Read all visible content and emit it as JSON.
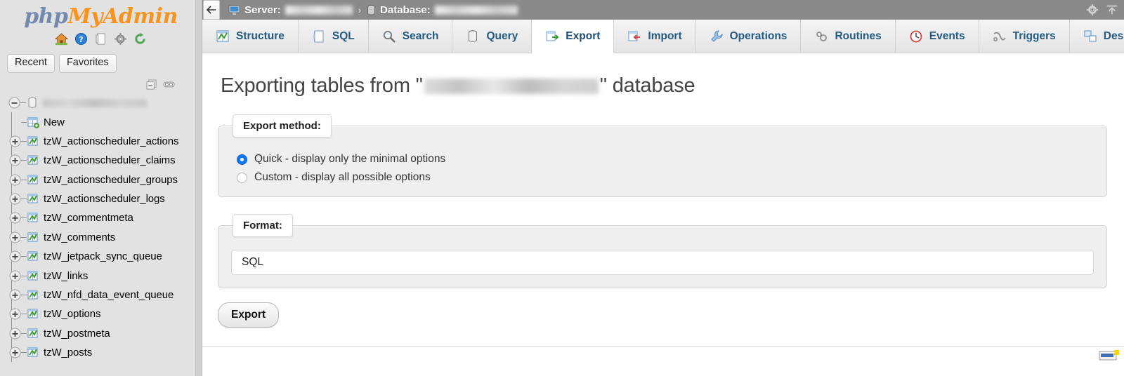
{
  "brand": {
    "logo_php": "php",
    "logo_my": "My",
    "logo_admin": "Admin",
    "icons": [
      "home-icon",
      "help-icon",
      "documentation-icon",
      "settings-icon",
      "reload-icon"
    ]
  },
  "sidebar": {
    "recent_label": "Recent",
    "favorites_label": "Favorites",
    "tree_tools": [
      "collapse-all-icon",
      "link-with-main-panel-icon"
    ],
    "database_name_redacted": true,
    "new_label": "New",
    "tables": [
      "tzW_actionscheduler_actions",
      "tzW_actionscheduler_claims",
      "tzW_actionscheduler_groups",
      "tzW_actionscheduler_logs",
      "tzW_commentmeta",
      "tzW_comments",
      "tzW_jetpack_sync_queue",
      "tzW_links",
      "tzW_nfd_data_event_queue",
      "tzW_options",
      "tzW_postmeta",
      "tzW_posts"
    ]
  },
  "topbar": {
    "back_icon": "back-arrow-icon",
    "server_label": "Server:",
    "server_icon": "server-icon",
    "separator": "›",
    "database_label": "Database:",
    "database_icon": "database-icon",
    "settings_icon": "gear-icon",
    "collapse_icon": "collapse-up-icon"
  },
  "tabs": [
    {
      "label": "Structure",
      "icon": "structure-icon",
      "active": false
    },
    {
      "label": "SQL",
      "icon": "sql-icon",
      "active": false
    },
    {
      "label": "Search",
      "icon": "search-icon",
      "active": false
    },
    {
      "label": "Query",
      "icon": "query-icon",
      "active": false
    },
    {
      "label": "Export",
      "icon": "export-icon",
      "active": true
    },
    {
      "label": "Import",
      "icon": "import-icon",
      "active": false
    },
    {
      "label": "Operations",
      "icon": "wrench-icon",
      "active": false
    },
    {
      "label": "Routines",
      "icon": "routines-icon",
      "active": false
    },
    {
      "label": "Events",
      "icon": "clock-icon",
      "active": false
    },
    {
      "label": "Triggers",
      "icon": "triggers-icon",
      "active": false
    },
    {
      "label": "Designer",
      "icon": "designer-icon",
      "active": false
    }
  ],
  "main": {
    "title_prefix": "Exporting tables from \"",
    "title_suffix": "\" database",
    "export_method": {
      "legend": "Export method:",
      "options": [
        {
          "label": "Quick - display only the minimal options",
          "selected": true
        },
        {
          "label": "Custom - display all possible options",
          "selected": false
        }
      ]
    },
    "format": {
      "legend": "Format:",
      "value": "SQL"
    },
    "export_button": "Export",
    "console_icon": "console-icon"
  },
  "colors": {
    "brand_blue": "#7389ae",
    "brand_orange": "#f7941d",
    "tab_text": "#235a81",
    "radio_selected": "#1076f3",
    "topbar_bg": "#8a8a8a",
    "sidebar_bg": "#e2e2e2"
  }
}
